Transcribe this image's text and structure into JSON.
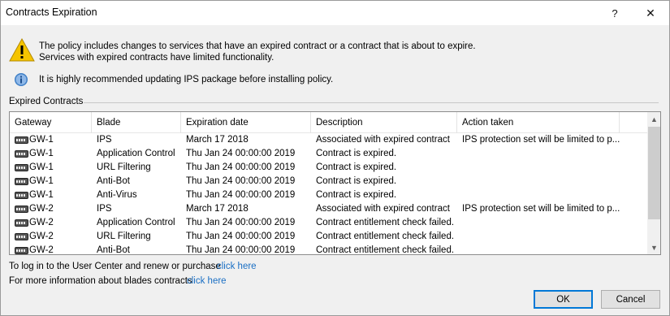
{
  "window": {
    "title": "Contracts Expiration",
    "help_glyph": "?",
    "close_glyph": "✕"
  },
  "messages": {
    "line1": "The policy includes changes to services that have an expired contract or a contract that is about to expire.",
    "line2": "Services with expired contracts have limited functionality.",
    "info": "It is highly recommended updating IPS package before installing policy."
  },
  "expired_contracts": {
    "group_label": "Expired Contracts",
    "columns": [
      "Gateway",
      "Blade",
      "Expiration date",
      "Description",
      "Action taken"
    ],
    "rows": [
      {
        "gateway": "GW-1",
        "blade": "IPS",
        "expiration": "March 17 2018",
        "description": "Associated with expired contract",
        "action": "IPS protection set will be limited to p..."
      },
      {
        "gateway": "GW-1",
        "blade": "Application Control",
        "expiration": "Thu Jan 24 00:00:00 2019",
        "description": "Contract is expired.",
        "action": ""
      },
      {
        "gateway": "GW-1",
        "blade": "URL Filtering",
        "expiration": "Thu Jan 24 00:00:00 2019",
        "description": "Contract is expired.",
        "action": ""
      },
      {
        "gateway": "GW-1",
        "blade": "Anti-Bot",
        "expiration": "Thu Jan 24 00:00:00 2019",
        "description": "Contract is expired.",
        "action": ""
      },
      {
        "gateway": "GW-1",
        "blade": "Anti-Virus",
        "expiration": "Thu Jan 24 00:00:00 2019",
        "description": "Contract is expired.",
        "action": ""
      },
      {
        "gateway": "GW-2",
        "blade": "IPS",
        "expiration": "March 17 2018",
        "description": "Associated with expired contract",
        "action": "IPS protection set will be limited to p..."
      },
      {
        "gateway": "GW-2",
        "blade": "Application Control",
        "expiration": "Thu Jan 24 00:00:00 2019",
        "description": "Contract entitlement check failed.",
        "action": ""
      },
      {
        "gateway": "GW-2",
        "blade": "URL Filtering",
        "expiration": "Thu Jan 24 00:00:00 2019",
        "description": "Contract entitlement check failed.",
        "action": ""
      },
      {
        "gateway": "GW-2",
        "blade": "Anti-Bot",
        "expiration": "Thu Jan 24 00:00:00 2019",
        "description": "Contract entitlement check failed.",
        "action": ""
      }
    ],
    "scroll_up_glyph": "▲",
    "scroll_down_glyph": "▼"
  },
  "footer": {
    "user_center_text": "To log in to the User Center and renew or purchase",
    "user_center_link": "click here",
    "blades_info_text": "For more information about blades contracts",
    "blades_info_link": "click here"
  },
  "buttons": {
    "ok": "OK",
    "cancel": "Cancel"
  },
  "icons": {
    "warning": "warning-icon",
    "info": "info-icon",
    "gateway": "gateway-icon",
    "link_color": "#1a6fc4",
    "warning_color": "#f5c400",
    "info_color": "#3f7fc6"
  }
}
